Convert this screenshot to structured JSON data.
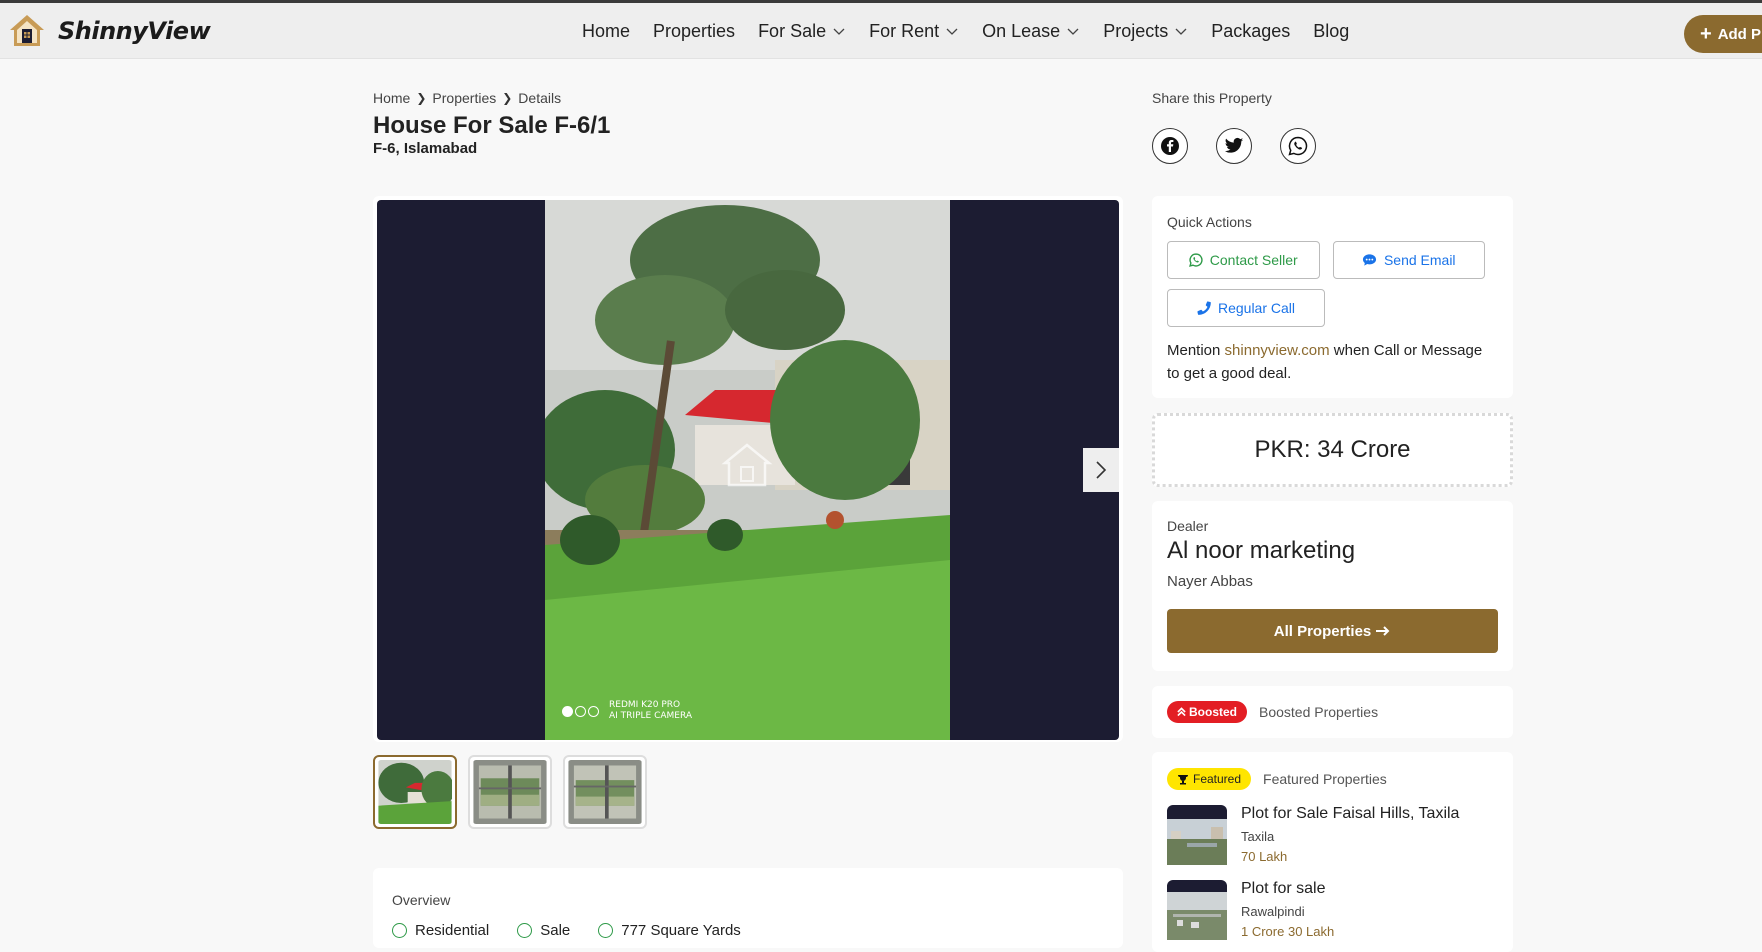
{
  "brand": {
    "name": "ShinnyView"
  },
  "nav": {
    "items": [
      {
        "label": "Home"
      },
      {
        "label": "Properties"
      },
      {
        "label": "For Sale"
      },
      {
        "label": "For Rent"
      },
      {
        "label": "On Lease"
      },
      {
        "label": "Projects"
      },
      {
        "label": "Packages"
      },
      {
        "label": "Blog"
      }
    ],
    "add_label": "Add Pro"
  },
  "breadcrumb": [
    "Home",
    "Properties",
    "Details"
  ],
  "property": {
    "title": "House For Sale F-6/1",
    "location": "F-6, Islamabad",
    "photo_caption_line1": "REDMI K20 PRO",
    "photo_caption_line2": "AI TRIPLE CAMERA"
  },
  "share": {
    "label": "Share this Property"
  },
  "quick_actions": {
    "title": "Quick Actions",
    "contact": "Contact Seller",
    "email": "Send Email",
    "call": "Regular Call",
    "mention_prefix": "Mention",
    "mention_link": "shinnyview.com",
    "mention_suffix": "when Call or Message to get a good deal."
  },
  "price": "PKR: 34 Crore",
  "dealer": {
    "label": "Dealer",
    "name": "Al noor marketing",
    "person": "Nayer Abbas",
    "all_button": "All Properties"
  },
  "boosted": {
    "badge": "Boosted",
    "label": "Boosted Properties"
  },
  "featured": {
    "badge": "Featured",
    "label": "Featured Properties",
    "items": [
      {
        "title": "Plot for Sale Faisal Hills, Taxila",
        "city": "Taxila",
        "price": "70 Lakh"
      },
      {
        "title": "Plot for sale",
        "city": "Rawalpindi",
        "price": "1 Crore 30 Lakh"
      }
    ]
  },
  "overview": {
    "title": "Overview",
    "items": [
      "Residential",
      "Sale",
      "777 Square Yards"
    ]
  },
  "colors": {
    "accent": "#8b6a2f",
    "boosted": "#e31e24",
    "featured": "#ffe500",
    "whatsapp": "#2e9a48",
    "link": "#1a73e8"
  }
}
